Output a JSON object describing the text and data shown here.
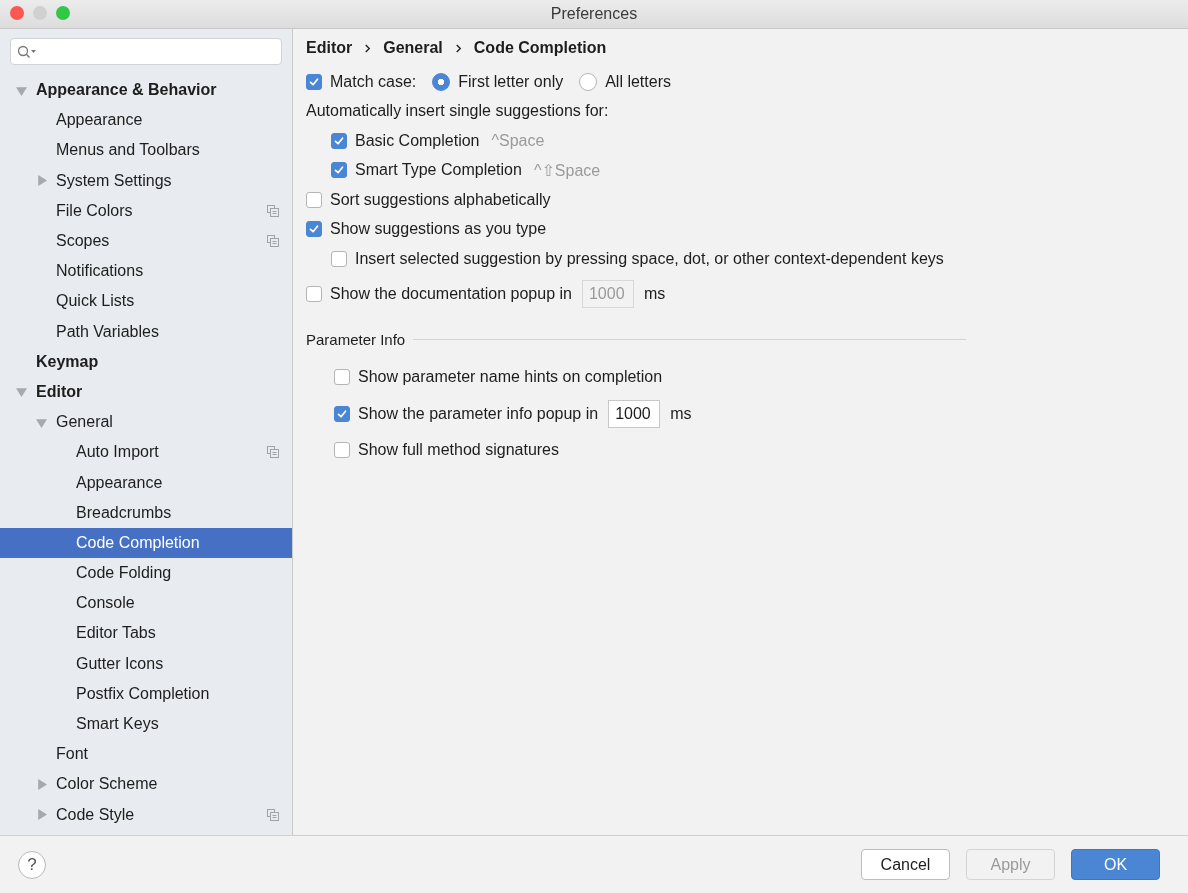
{
  "window": {
    "title": "Preferences"
  },
  "sidebar": {
    "tree": [
      {
        "label": "Appearance & Behavior",
        "expanded": true,
        "selected": false,
        "children": [
          {
            "label": "Appearance",
            "selected": false
          },
          {
            "label": "Menus and Toolbars",
            "selected": false
          },
          {
            "label": "System Settings",
            "expanded": false,
            "selected": false
          },
          {
            "label": "File Colors",
            "selected": false,
            "project_icon": true
          },
          {
            "label": "Scopes",
            "selected": false,
            "project_icon": true
          },
          {
            "label": "Notifications",
            "selected": false
          },
          {
            "label": "Quick Lists",
            "selected": false
          },
          {
            "label": "Path Variables",
            "selected": false
          }
        ]
      },
      {
        "label": "Keymap",
        "selected": false
      },
      {
        "label": "Editor",
        "expanded": true,
        "selected": false,
        "children": [
          {
            "label": "General",
            "expanded": true,
            "selected": false,
            "children": [
              {
                "label": "Auto Import",
                "selected": false,
                "project_icon": true
              },
              {
                "label": "Appearance",
                "selected": false
              },
              {
                "label": "Breadcrumbs",
                "selected": false
              },
              {
                "label": "Code Completion",
                "selected": true
              },
              {
                "label": "Code Folding",
                "selected": false
              },
              {
                "label": "Console",
                "selected": false
              },
              {
                "label": "Editor Tabs",
                "selected": false
              },
              {
                "label": "Gutter Icons",
                "selected": false
              },
              {
                "label": "Postfix Completion",
                "selected": false
              },
              {
                "label": "Smart Keys",
                "selected": false
              }
            ]
          },
          {
            "label": "Font",
            "selected": false
          },
          {
            "label": "Color Scheme",
            "expanded": false,
            "selected": false
          },
          {
            "label": "Code Style",
            "expanded": false,
            "selected": false,
            "project_icon": true
          }
        ]
      }
    ]
  },
  "breadcrumb": [
    "Editor",
    "General",
    "Code Completion"
  ],
  "options": [
    {
      "kind": "match_case",
      "label": "Match case:",
      "checked": true,
      "radios": [
        {
          "label": "First letter only",
          "selected": true
        },
        {
          "label": "All letters",
          "selected": false
        }
      ]
    },
    {
      "kind": "heading",
      "label": "Automatically insert single suggestions for:",
      "children": [
        {
          "kind": "checkbox",
          "label": "Basic Completion",
          "checked": true,
          "shortcut": "^Space"
        },
        {
          "kind": "checkbox",
          "label": "Smart Type Completion",
          "checked": true,
          "shortcut": "^⇧Space"
        }
      ]
    },
    {
      "kind": "checkbox",
      "label": "Sort suggestions alphabetically",
      "checked": false
    },
    {
      "kind": "checkbox",
      "label": "Show suggestions as you type",
      "checked": true,
      "children": [
        {
          "kind": "checkbox",
          "label": "Insert selected suggestion by pressing space, dot, or other context-dependent keys",
          "checked": false
        }
      ]
    },
    {
      "kind": "checkbox_field",
      "label": "Show the documentation popup in",
      "checked": false,
      "value": "1000",
      "unit": "ms",
      "disabled": true
    }
  ],
  "parameter_info": {
    "title": "Parameter Info",
    "options": [
      {
        "kind": "checkbox",
        "label": "Show parameter name hints on completion",
        "checked": false
      },
      {
        "kind": "checkbox_field",
        "label": "Show the parameter info popup in",
        "checked": true,
        "value": "1000",
        "unit": "ms",
        "disabled": false
      },
      {
        "kind": "checkbox",
        "label": "Show full method signatures",
        "checked": false
      }
    ]
  },
  "footer": {
    "help": "?",
    "buttons": [
      {
        "label": "Cancel",
        "kind": "default",
        "disabled": false
      },
      {
        "label": "Apply",
        "kind": "default",
        "disabled": true
      },
      {
        "label": "OK",
        "kind": "primary",
        "disabled": false
      }
    ]
  }
}
